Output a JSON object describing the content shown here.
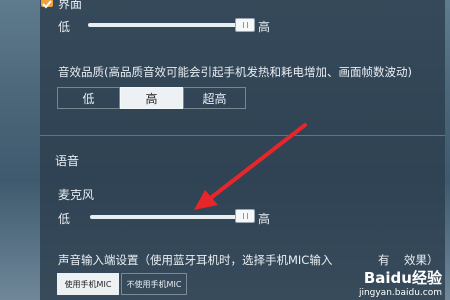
{
  "display": {
    "section_label": "界面",
    "slider_min": "低",
    "slider_max": "高",
    "slider_level": 0.8
  },
  "audio_quality": {
    "label": "音效品质(高品质音效可能会引起手机发热和耗电增加、画面帧数波动)",
    "options": [
      "低",
      "高",
      "超高"
    ],
    "selected": "高"
  },
  "voice": {
    "section_title": "语音",
    "mic_label": "麦克风",
    "slider_min": "低",
    "slider_max": "高",
    "slider_level": 0.8
  },
  "input_setting": {
    "label": "声音输入端设置（使用蓝牙耳机时，选择手机MIC输入",
    "label_tail": "有",
    "label_end": "效果）",
    "options": [
      "使用手机MIC",
      "不使用手机MIC"
    ],
    "selected": "使用手机MIC"
  },
  "watermark": {
    "brand": "Baidu",
    "brand_suffix": "经验",
    "url": "jingyan.baidu.com"
  },
  "colors": {
    "accent": "#f0a23a",
    "annotation_arrow": "#e8262a"
  }
}
